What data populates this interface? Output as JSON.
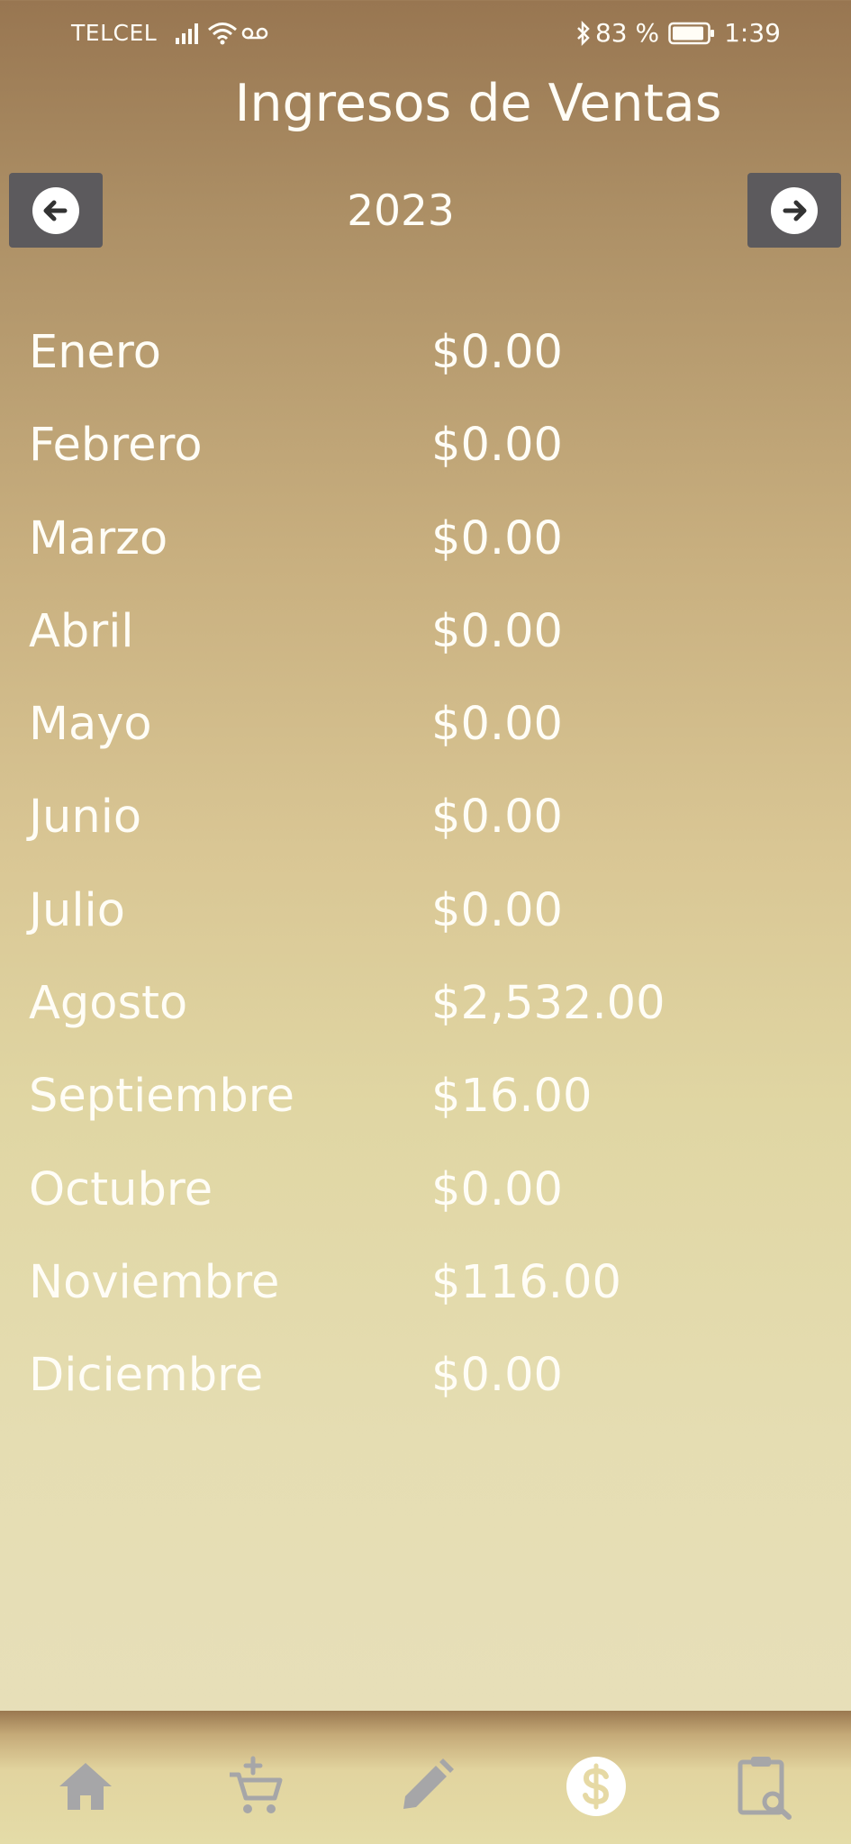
{
  "status_bar": {
    "carrier": "TELCEL",
    "battery_percent": "83 %",
    "time": "1:39"
  },
  "header": {
    "title": "Ingresos de Ventas",
    "year": "2023"
  },
  "income": {
    "rows": [
      {
        "month": "Enero",
        "amount": "$0.00"
      },
      {
        "month": "Febrero",
        "amount": "$0.00"
      },
      {
        "month": "Marzo",
        "amount": "$0.00"
      },
      {
        "month": "Abril",
        "amount": "$0.00"
      },
      {
        "month": "Mayo",
        "amount": "$0.00"
      },
      {
        "month": "Junio",
        "amount": "$0.00"
      },
      {
        "month": "Julio",
        "amount": "$0.00"
      },
      {
        "month": "Agosto",
        "amount": "$2,532.00"
      },
      {
        "month": "Septiembre",
        "amount": "$16.00"
      },
      {
        "month": "Octubre",
        "amount": "$0.00"
      },
      {
        "month": "Noviembre",
        "amount": "$116.00"
      },
      {
        "month": "Diciembre",
        "amount": "$0.00"
      }
    ]
  },
  "bottom_nav": {
    "items": [
      {
        "icon": "home-icon",
        "active": false
      },
      {
        "icon": "add-to-cart-icon",
        "active": false
      },
      {
        "icon": "pencil-icon",
        "active": false
      },
      {
        "icon": "dollar-icon",
        "active": true
      },
      {
        "icon": "clipboard-search-icon",
        "active": false
      }
    ]
  },
  "colors": {
    "text": "#fffdf6",
    "nav_button_bg": "#5c5a5d",
    "nav_icon_inactive": "#a6a6a8",
    "nav_icon_active": "#ffffff"
  }
}
